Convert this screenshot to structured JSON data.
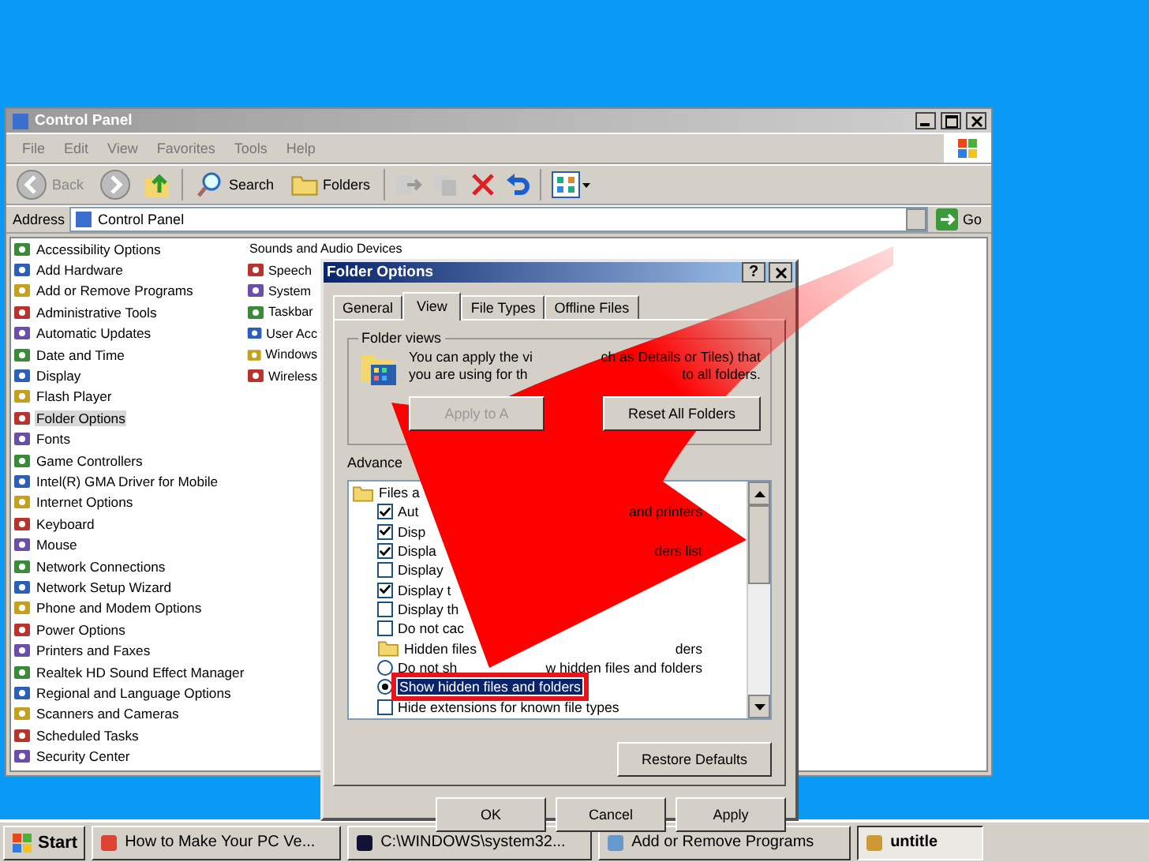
{
  "window": {
    "title": "Control Panel",
    "menu": [
      "File",
      "Edit",
      "View",
      "Favorites",
      "Tools",
      "Help"
    ],
    "toolbar": {
      "back": {
        "label": "Back",
        "disabled": true
      },
      "search": "Search",
      "folders": "Folders"
    },
    "address": {
      "label": "Address",
      "value": "Control Panel",
      "go": "Go"
    },
    "items_left": [
      {
        "label": "Accessibility Options",
        "selected": false
      },
      {
        "label": "Add Hardware",
        "selected": false
      },
      {
        "label": "Add or Remove Programs",
        "selected": false
      },
      {
        "label": "Administrative Tools",
        "selected": false
      },
      {
        "label": "Automatic Updates",
        "selected": false
      },
      {
        "label": "Date and Time",
        "selected": false
      },
      {
        "label": "Display",
        "selected": false
      },
      {
        "label": "Flash Player",
        "selected": false
      },
      {
        "label": "Folder Options",
        "selected": true
      },
      {
        "label": "Fonts",
        "selected": false
      },
      {
        "label": "Game Controllers",
        "selected": false
      },
      {
        "label": "Intel(R) GMA Driver for Mobile",
        "selected": false
      },
      {
        "label": "Internet Options",
        "selected": false
      },
      {
        "label": "Keyboard",
        "selected": false
      },
      {
        "label": "Mouse",
        "selected": false
      },
      {
        "label": "Network Connections",
        "selected": false
      },
      {
        "label": "Network Setup Wizard",
        "selected": false
      },
      {
        "label": "Phone and Modem Options",
        "selected": false
      },
      {
        "label": "Power Options",
        "selected": false
      },
      {
        "label": "Printers and Faxes",
        "selected": false
      },
      {
        "label": "Realtek HD Sound Effect Manager",
        "selected": false
      },
      {
        "label": "Regional and Language Options",
        "selected": false
      },
      {
        "label": "Scanners and Cameras",
        "selected": false
      },
      {
        "label": "Scheduled Tasks",
        "selected": false
      },
      {
        "label": "Security Center",
        "selected": false
      }
    ],
    "items_right": [
      {
        "label": "Sounds and Audio Devices",
        "selected": false
      },
      {
        "label": "Speech",
        "selected": false
      },
      {
        "label": "System",
        "selected": false
      },
      {
        "label": "Taskbar",
        "selected": false
      },
      {
        "label": "User Acc",
        "selected": false
      },
      {
        "label": "Windows",
        "selected": false
      },
      {
        "label": "Wireless",
        "selected": false
      }
    ]
  },
  "dialog": {
    "title": "Folder Options",
    "help": "?",
    "tabs": [
      {
        "label": "General",
        "selected": false
      },
      {
        "label": "View",
        "selected": true
      },
      {
        "label": "File Types",
        "selected": false
      },
      {
        "label": "Offline Files",
        "selected": false
      }
    ],
    "folder_views": {
      "legend": "Folder views",
      "lines": [
        {
          "start": "You can apply the vi",
          "end": "ch as Details or Tiles) that"
        },
        {
          "start": "you are using for th",
          "end": "to all folders."
        }
      ],
      "buttons": [
        {
          "label": "Apply to A",
          "disabled": true
        },
        {
          "label": "Reset All Folders",
          "disabled": false
        }
      ]
    },
    "advanced": {
      "label": "Advance",
      "rows": [
        {
          "kind": "folder",
          "start": "Files a"
        },
        {
          "kind": "check",
          "checked": true,
          "start": "Aut",
          "end": "and printers"
        },
        {
          "kind": "check",
          "checked": true,
          "start": "Disp"
        },
        {
          "kind": "check",
          "checked": true,
          "start": "Displa",
          "end": "ders list"
        },
        {
          "kind": "check",
          "checked": false,
          "start": "Display"
        },
        {
          "kind": "check",
          "checked": true,
          "start": "Display t"
        },
        {
          "kind": "check",
          "checked": false,
          "start": "Display th"
        },
        {
          "kind": "check",
          "checked": false,
          "start": "Do not cac"
        },
        {
          "kind": "folder",
          "start": "Hidden files",
          "end": "ders"
        },
        {
          "kind": "radio",
          "selected": false,
          "start": "Do not sh",
          "end": "w hidden files and folders"
        },
        {
          "kind": "radio",
          "selected": true,
          "start": "Show hidden files and folders"
        },
        {
          "kind": "check",
          "checked": false,
          "start": "Hide extensions for known file types"
        }
      ]
    },
    "restore": "Restore Defaults",
    "buttons": [
      "OK",
      "Cancel",
      "Apply"
    ]
  },
  "taskbar": {
    "start": "Start",
    "tasks": [
      {
        "label": "How to Make Your PC Ve...",
        "selected": false
      },
      {
        "label": "C:\\WINDOWS\\system32...",
        "selected": false
      },
      {
        "label": "Add or Remove Programs",
        "selected": false
      },
      {
        "label": "untitle",
        "selected": true
      }
    ]
  }
}
